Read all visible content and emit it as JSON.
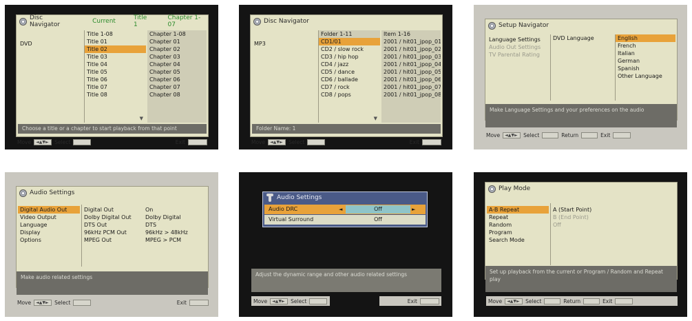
{
  "colors": {
    "highlight": "#e8a23a",
    "panel": "#e4e3c6",
    "hint_bar": "#6d6c66",
    "dark_bg": "#141414",
    "light_bg": "#c9c7bf",
    "dialog": "#4a5a87"
  },
  "footer": {
    "move": "Move",
    "select": "Select",
    "return": "Return",
    "exit": "Exit"
  },
  "s1": {
    "title": "Disc Navigator",
    "head_mid": "Title 1-08",
    "head_a": "Current",
    "head_b": "Title 1",
    "head_c": "Chapter 1-07",
    "left_item": "DVD",
    "titles": [
      "Title 01",
      "Title 02",
      "Title 03",
      "Title 04",
      "Title 05",
      "Title 06",
      "Title 07",
      "Title 08"
    ],
    "chapters_head": "Chapter 1-08",
    "chapters": [
      "Chapter 01",
      "Chapter 02",
      "Chapter 03",
      "Chapter 04",
      "Chapter 05",
      "Chapter 06",
      "Chapter 07",
      "Chapter 08"
    ],
    "hint": "Choose a title or a chapter to start playback from that point"
  },
  "s2": {
    "title": "Disc Navigator",
    "head_mid": "Folder 1-11",
    "head_r": "Item 1-16",
    "left_item": "MP3",
    "folders": [
      "CD1/01",
      "CD2 / slow rock",
      "CD3 / hip hop",
      "CD4 / jazz",
      "CD5 / dance",
      "CD6 / ballade",
      "CD7 / rock",
      "CD8 / pops"
    ],
    "files": [
      "2001 / hit01_jpop_01",
      "2001 / hit01_jpop_02",
      "2001 / hit01_jpop_03",
      "2001 / hit01_jpop_04",
      "2001 / hit01_jpop_05",
      "2001 / hit01_jpop_06",
      "2001 / hit01_jpop_07",
      "2001 / hit01_jpop_08"
    ],
    "hint": "Folder Name: 1"
  },
  "s3": {
    "title": "Setup Navigator",
    "menu": [
      "Language Settings",
      "Audio Out Settings",
      "TV Parental Rating"
    ],
    "submenu": "DVD Language",
    "options": [
      "English",
      "French",
      "Italian",
      "German",
      "Spanish",
      "Other Language"
    ],
    "hint": "Make Language Settings and your preferences on the audio"
  },
  "s4": {
    "title": "Audio Settings",
    "menu": [
      "Digital Audio Out",
      "Video Output",
      "Language",
      "Display",
      "Options"
    ],
    "col_a": [
      "Digital Out",
      "Dolby Digital Out",
      "DTS Out",
      "96kHz PCM Out",
      "MPEG Out"
    ],
    "col_b": [
      "On",
      "Dolby Digital",
      "DTS",
      "96kHz > 48kHz",
      "MPEG > PCM"
    ],
    "hint": "Make audio related settings"
  },
  "s5": {
    "title": "Audio Settings",
    "rows": [
      {
        "name": "Audio DRC",
        "value": "Off"
      },
      {
        "name": "Virtual Surround",
        "value": "Off"
      }
    ],
    "hint": "Adjust the dynamic range and other audio related settings"
  },
  "s6": {
    "title": "Play Mode",
    "menu": [
      "A-B Repeat",
      "Repeat",
      "Random",
      "Program",
      "Search Mode"
    ],
    "options": [
      "A (Start Point)",
      "B (End Point)",
      "Off"
    ],
    "hint": "Set up playback from the current or Program / Random and Repeat play"
  }
}
